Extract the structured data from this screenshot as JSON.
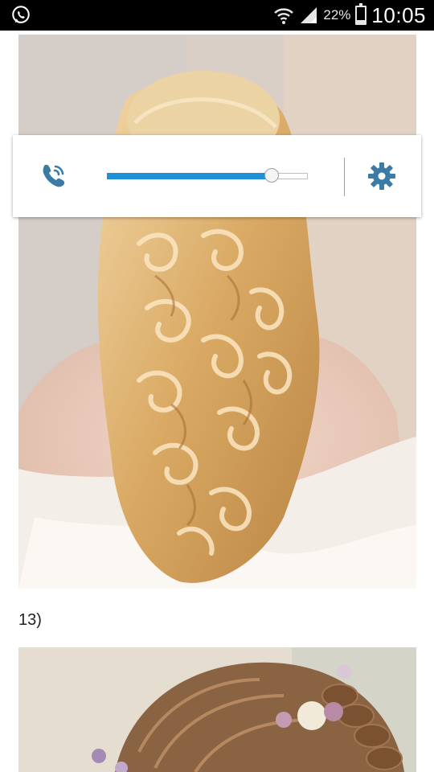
{
  "status_bar": {
    "battery_percent": "22%",
    "battery_level": 0.22,
    "time": "10:05",
    "icons": [
      "whatsapp-icon",
      "wifi-icon",
      "signal-icon",
      "battery-icon"
    ]
  },
  "content": {
    "caption": "13)"
  },
  "volume_panel": {
    "level": 0.82,
    "accent_color": "#1e90d6",
    "icons": [
      "phone-call-icon",
      "settings-gear-icon"
    ]
  }
}
